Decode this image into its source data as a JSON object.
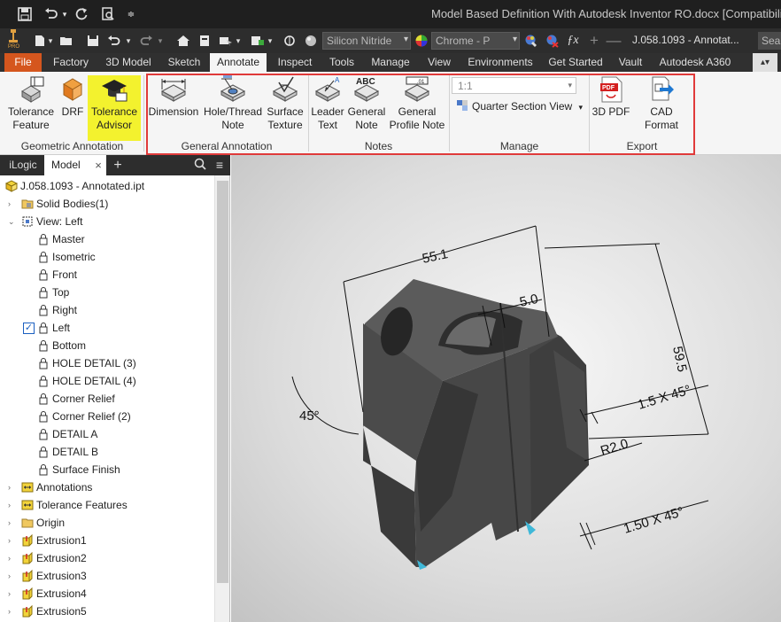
{
  "window": {
    "title": "Model Based Definition With Autodesk Inventor RO.docx [Compatibility Mo"
  },
  "qat": {
    "material": "Silicon Nitride",
    "appearance": "Chrome - P",
    "document": "J.058.1093 - Annotat...",
    "search_placeholder": "Sear"
  },
  "tabs": [
    "File",
    "Tools",
    "Sketch",
    "Annotate",
    "Inspect",
    "3D Model",
    "Manage",
    "View",
    "Environments",
    "Get Started",
    "Vault",
    "Autodesk A360"
  ],
  "tab_order": [
    "File",
    "Factory",
    "3D Model",
    "Sketch",
    "Annotate",
    "Inspect",
    "Tools",
    "Manage",
    "View",
    "Environments",
    "Get Started",
    "Vault",
    "Autodesk A360"
  ],
  "active_tab": "Annotate",
  "ribbon": {
    "tolerance_feature": [
      "Tolerance",
      "Feature"
    ],
    "drf": "DRF",
    "tolerance_advisor": [
      "Tolerance",
      "Advisor"
    ],
    "geometric_annotation": "Geometric Annotation",
    "dimension": "Dimension",
    "hole_thread_note": [
      "Hole/Thread",
      "Note"
    ],
    "surface_texture": [
      "Surface",
      "Texture"
    ],
    "general_annotation": "General Annotation",
    "leader_text": [
      "Leader",
      "Text"
    ],
    "general_note": [
      "General",
      "Note"
    ],
    "general_profile_note": [
      "General",
      "Profile Note"
    ],
    "notes": "Notes",
    "scale": "1:1",
    "quarter_section_view": "Quarter Section View",
    "manage": "Manage",
    "pdf_3d": "3D PDF",
    "cad_format": "CAD Format",
    "export": "Export",
    "icon_labels": {
      "abc": "ABC",
      "ref": ".01",
      "pdf": "PDF"
    }
  },
  "browser": {
    "tabs": [
      "iLogic",
      "Model"
    ],
    "active_tab": "Model",
    "add": "+",
    "root": "J.058.1093 - Annotated.ipt",
    "items": [
      {
        "label": "Solid Bodies(1)",
        "level": 1,
        "icon": "folder-solid-icon"
      },
      {
        "label": "View: Left",
        "level": 1,
        "icon": "view-icon"
      },
      {
        "label": "Master",
        "level": 2,
        "icon": "lock-icon"
      },
      {
        "label": "Isometric",
        "level": 2,
        "icon": "lock-icon"
      },
      {
        "label": "Front",
        "level": 2,
        "icon": "lock-icon"
      },
      {
        "label": "Top",
        "level": 2,
        "icon": "lock-icon"
      },
      {
        "label": "Right",
        "level": 2,
        "icon": "lock-icon"
      },
      {
        "label": "Left",
        "level": 2,
        "icon": "lock-icon",
        "checked": true
      },
      {
        "label": "Bottom",
        "level": 2,
        "icon": "lock-icon"
      },
      {
        "label": "HOLE DETAIL (3)",
        "level": 2,
        "icon": "lock-icon"
      },
      {
        "label": "HOLE DETAIL (4)",
        "level": 2,
        "icon": "lock-icon"
      },
      {
        "label": "Corner Relief",
        "level": 2,
        "icon": "lock-icon"
      },
      {
        "label": "Corner Relief (2)",
        "level": 2,
        "icon": "lock-icon"
      },
      {
        "label": "DETAIL A",
        "level": 2,
        "icon": "lock-icon"
      },
      {
        "label": "DETAIL B",
        "level": 2,
        "icon": "lock-icon"
      },
      {
        "label": "Surface Finish",
        "level": 2,
        "icon": "lock-icon"
      },
      {
        "label": "Annotations",
        "level": 1,
        "icon": "annotation-icon"
      },
      {
        "label": "Tolerance Features",
        "level": 1,
        "icon": "annotation-icon"
      },
      {
        "label": "Origin",
        "level": 1,
        "icon": "folder-icon"
      },
      {
        "label": "Extrusion1",
        "level": 1,
        "icon": "extrusion-icon"
      },
      {
        "label": "Extrusion2",
        "level": 1,
        "icon": "extrusion-icon"
      },
      {
        "label": "Extrusion3",
        "level": 1,
        "icon": "extrusion-icon"
      },
      {
        "label": "Extrusion4",
        "level": 1,
        "icon": "extrusion-icon"
      },
      {
        "label": "Extrusion5",
        "level": 1,
        "icon": "extrusion-icon"
      }
    ]
  },
  "model": {
    "dims": {
      "width": "55.1",
      "slot": "5.0",
      "height": "59.5",
      "angle": "45°",
      "chamfer1": "1.5 X 45°",
      "radius": "R2.0",
      "chamfer2": "1.50 X 45°"
    }
  },
  "colors": {
    "file_tab": "#d5561e",
    "highlight": "#f3f22e",
    "red_box": "#e03a3a",
    "part": "#4a4a4a"
  }
}
